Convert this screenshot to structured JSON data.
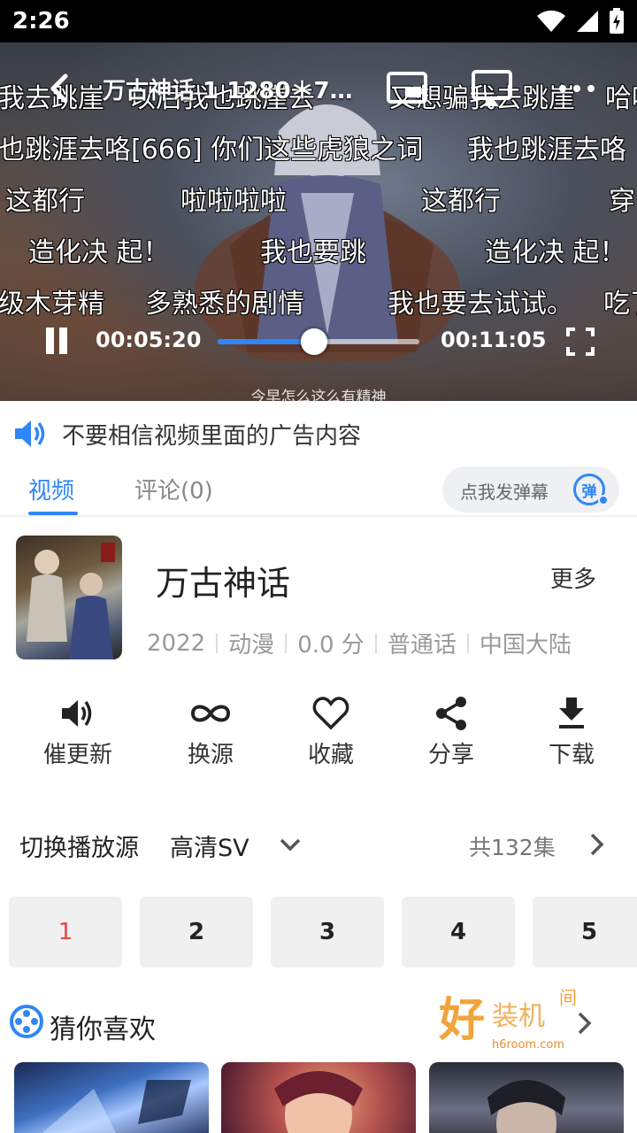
{
  "status_bar": {
    "time": "2:26"
  },
  "player": {
    "title": "万古神话   1 1280＊7…",
    "current_time": "00:05:20",
    "total_time": "00:11:05",
    "progress": 0.48,
    "subtitle": "今早怎么这么有精神",
    "danmu": [
      "我去跳崖",
      "以后我也跳崖去",
      "又想骗我去跳崖",
      "哈哈",
      "也跳涯去咯[666] 你们这些虎狼之词",
      "我也跳涯去咯",
      "这都行",
      "啦啦啦啦",
      "这都行",
      "穿",
      "造化决 起！",
      "我也要跳",
      "造化决 起！",
      "级木芽精",
      "多熟悉的剧情",
      "我也要去试试。",
      "吃了"
    ]
  },
  "notice": {
    "text": "不要相信视频里面的广告内容"
  },
  "tabs": {
    "video": "视频",
    "comments": "评论(0)",
    "danmu_placeholder": "点我发弹幕",
    "danmu_icon_char": "弹"
  },
  "info": {
    "title": "万古神话",
    "more": "更多",
    "meta": [
      "2022",
      "动漫",
      "0.0 分",
      "普通话",
      "中国大陆"
    ]
  },
  "actions": [
    {
      "label": "催更新",
      "icon": "speaker-icon"
    },
    {
      "label": "换源",
      "icon": "infinity-icon"
    },
    {
      "label": "收藏",
      "icon": "heart-icon"
    },
    {
      "label": "分享",
      "icon": "share-icon"
    },
    {
      "label": "下载",
      "icon": "download-icon"
    }
  ],
  "source": {
    "label": "切换播放源",
    "value": "高清SV",
    "episode_count": "共132集"
  },
  "episodes": [
    "1",
    "2",
    "3",
    "4",
    "5"
  ],
  "recommend": {
    "title": "猜你喜欢",
    "watermark": "好装机 h6room.com"
  },
  "colors": {
    "accent": "#2f86f6",
    "active_episode": "#e44444"
  }
}
